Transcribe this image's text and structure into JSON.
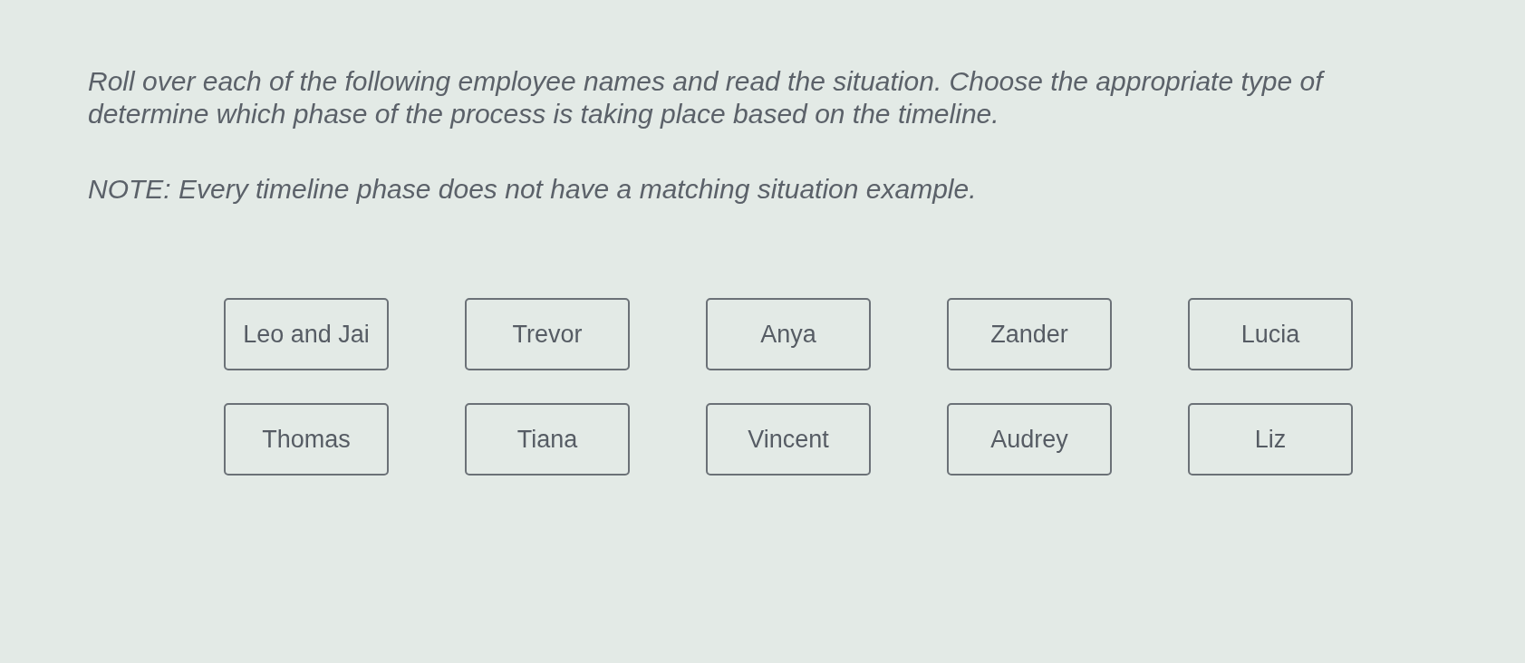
{
  "instruction_lines": [
    "Roll over each of the following employee names and read the situation. Choose the appropriate type of",
    "determine which phase of the process is taking place based on the timeline."
  ],
  "note": "NOTE: Every timeline phase does not have a matching situation example.",
  "employees": [
    {
      "label": "Leo and Jai"
    },
    {
      "label": "Trevor"
    },
    {
      "label": "Anya"
    },
    {
      "label": "Zander"
    },
    {
      "label": "Lucia"
    },
    {
      "label": "Thomas"
    },
    {
      "label": "Tiana"
    },
    {
      "label": "Vincent"
    },
    {
      "label": "Audrey"
    },
    {
      "label": "Liz"
    }
  ]
}
